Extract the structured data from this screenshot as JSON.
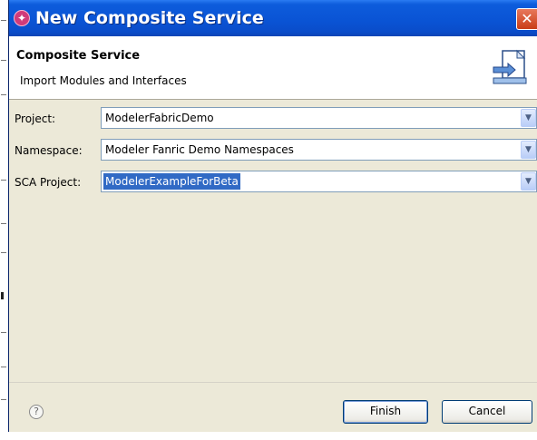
{
  "window": {
    "title": "New Composite Service"
  },
  "banner": {
    "title": "Composite Service",
    "description": "Import Modules and Interfaces"
  },
  "form": {
    "fields": [
      {
        "label": "Project:",
        "value": "ModelerFabricDemo"
      },
      {
        "label": "Namespace:",
        "value": "Modeler Fanric Demo Namespaces"
      },
      {
        "label": "SCA Project:",
        "value": "ModelerExampleForBeta"
      }
    ]
  },
  "buttons": {
    "finish_label": "Finish",
    "cancel_label": "Cancel",
    "help_glyph": "?"
  },
  "icons": {
    "app": "eclipse-wizard-icon",
    "close": "close-icon",
    "help": "help-icon",
    "banner": "composite-service-wizard-icon",
    "dropdown": "chevron-down-icon"
  },
  "colors": {
    "titlebar": "#0a53d4",
    "selection": "#316ac5",
    "dialog_bg": "#ece9d8"
  }
}
